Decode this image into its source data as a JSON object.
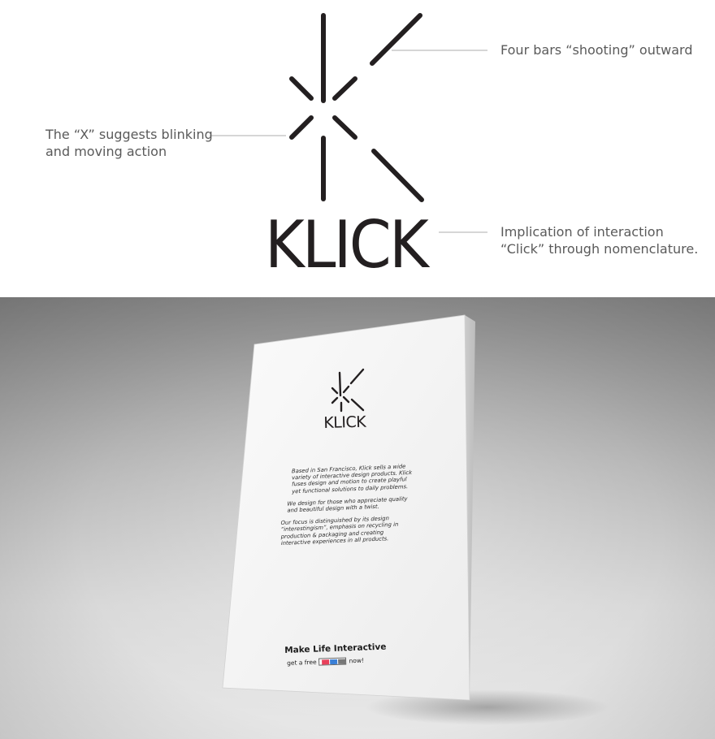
{
  "diagram": {
    "brand": "KLICK",
    "callouts": {
      "bars": "Four bars “shooting” outward",
      "x_line1": "The “X” suggests blinking",
      "x_line2": "and moving action",
      "click_line1": "Implication of  interaction",
      "click_line2": "“Click” through nomenclature."
    },
    "colors": {
      "ink": "#231f20",
      "callout_text": "#5a5a5a",
      "leader": "#c8c8c8"
    },
    "icon": "klick-logo-mark"
  },
  "card": {
    "brand": "KLICK",
    "paragraphs": [
      "Based in San Francisco, Klick sells a wide variety of interactive design products. Klick fuses design and motion to create playful yet functional solutions to daily problems.",
      "We design for those who appreciate quality and beautiful design with a twist.",
      "Our focus is distinguished by its design “interestingism”, emphasis on recycling in production & packaging and creating interactive experiences in all products."
    ],
    "tagline": "Make Life Interactive",
    "cta_before": "get a free",
    "cta_after": "now!",
    "icon": "klick-logo-mark",
    "badge_icon": "3d-glasses-icon",
    "colors": {
      "paper": "#f7f7f7",
      "backdrop": "#b9b9b9"
    }
  }
}
